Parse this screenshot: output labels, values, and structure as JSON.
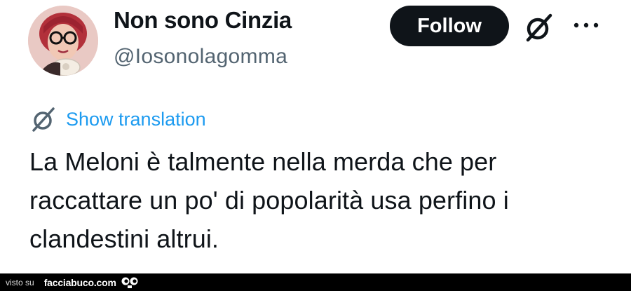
{
  "header": {
    "display_name": "Non sono Cinzia",
    "handle": "@Iosonolagomma",
    "follow_label": "Follow",
    "icons": {
      "avatar": "profile-photo",
      "grok": "grok-icon",
      "more": "more-dots-icon"
    }
  },
  "tweet": {
    "translate_label": "Show translation",
    "text": "La Meloni è talmente nella merda che per raccattare un po' di popolarità usa perfino i clandestini altrui."
  },
  "footer": {
    "prefix": "visto su",
    "brand": "facciabuco.com"
  },
  "colors": {
    "accent": "#1d9bf0",
    "text": "#0f1419",
    "muted": "#536471",
    "button": "#0f1419"
  }
}
